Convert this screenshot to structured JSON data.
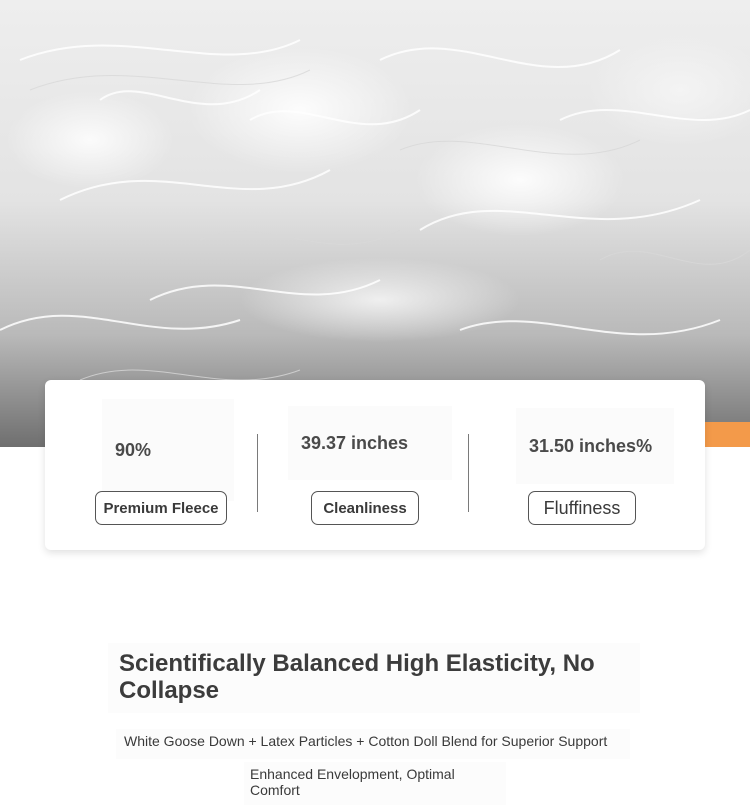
{
  "stats": [
    {
      "value": "90%",
      "label": "Premium Fleece"
    },
    {
      "value": "39.37 inches",
      "label": "Cleanliness"
    },
    {
      "value": "31.50 inches%",
      "label": "Fluffiness"
    }
  ],
  "feature": {
    "headline": "Scientifically Balanced High Elasticity, No Collapse",
    "subline": "White Goose Down + Latex Particles + Cotton Doll Blend for Superior Support",
    "bullet": "Enhanced Envelopment, Optimal Comfort"
  },
  "colors": {
    "accent": "#f39a4a",
    "text": "#3a3a3a"
  }
}
